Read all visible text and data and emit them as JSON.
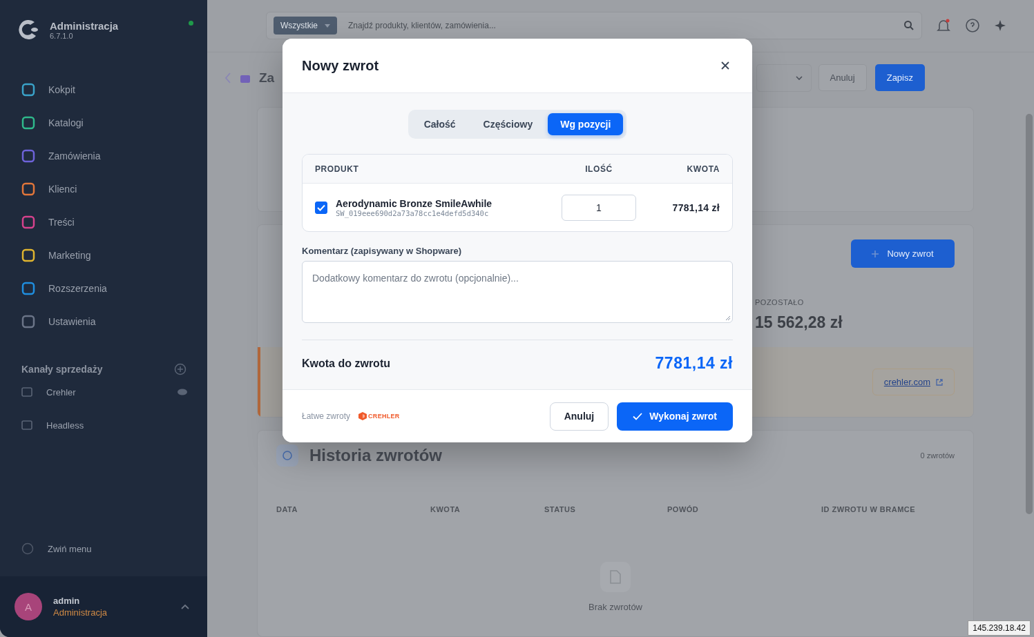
{
  "sidebar": {
    "title": "Administracja",
    "version": "6.7.1.0",
    "online": true,
    "nav": [
      {
        "label": "Kokpit",
        "color": "#3aa3c9"
      },
      {
        "label": "Katalogi",
        "color": "#2fb98b"
      },
      {
        "label": "Zamówienia",
        "color": "#6e63d9"
      },
      {
        "label": "Klienci",
        "color": "#e2763a"
      },
      {
        "label": "Treści",
        "color": "#d6428d"
      },
      {
        "label": "Marketing",
        "color": "#e0b52f"
      },
      {
        "label": "Rozszerzenia",
        "color": "#1f8fe0"
      },
      {
        "label": "Ustawienia",
        "color": "#6b7588"
      }
    ],
    "channels_title": "Kanały sprzedaży",
    "channels": [
      {
        "label": "Crehler"
      },
      {
        "label": "Headless"
      }
    ],
    "collapse": "Zwiń menu",
    "user": {
      "initial": "A",
      "name": "admin",
      "role": "Administracja"
    }
  },
  "topbar": {
    "filter": "Wszystkie",
    "search_placeholder": "Znajdź produkty, klientów, zamówienia..."
  },
  "header": {
    "title": "Za",
    "cancel": "Anuluj",
    "save": "Zapisz"
  },
  "refund_card": {
    "new_button": "Nowy zwrot",
    "remaining_label": "POZOSTAŁO",
    "remaining_value": "15 562,28 zł",
    "link": "crehler.com"
  },
  "history": {
    "title": "Historia zwrotów",
    "count": "0 zwrotów",
    "columns": [
      "DATA",
      "KWOTA",
      "STATUS",
      "POWÓD",
      "ID ZWROTU W BRAMCE"
    ],
    "empty": "Brak zwrotów"
  },
  "modal": {
    "title": "Nowy zwrot",
    "tabs": [
      {
        "label": "Całość",
        "selected": false
      },
      {
        "label": "Częściowy",
        "selected": false
      },
      {
        "label": "Wg pozycji",
        "selected": true
      }
    ],
    "table": {
      "columns": [
        "PRODUKT",
        "ILOŚĆ",
        "KWOTA"
      ],
      "rows": [
        {
          "checked": true,
          "name": "Aerodynamic Bronze SmileAwhile",
          "sku": "SW_019eee690d2a73a78cc1e4defd5d340c",
          "quantity": "1",
          "amount": "7781,14 zł"
        }
      ]
    },
    "comment": {
      "label": "Komentarz (zapisywany w Shopware)",
      "placeholder": "Dodatkowy komentarz do zwrotu (opcjonalnie)..."
    },
    "total": {
      "label": "Kwota do zwrotu",
      "value": "7781,14 zł"
    },
    "footer": {
      "brand_text": "Łatwe zwroty",
      "logo": "CREHLER",
      "cancel": "Anuluj",
      "confirm": "Wykonaj zwrot"
    }
  },
  "ip_label": "145.239.18.42"
}
